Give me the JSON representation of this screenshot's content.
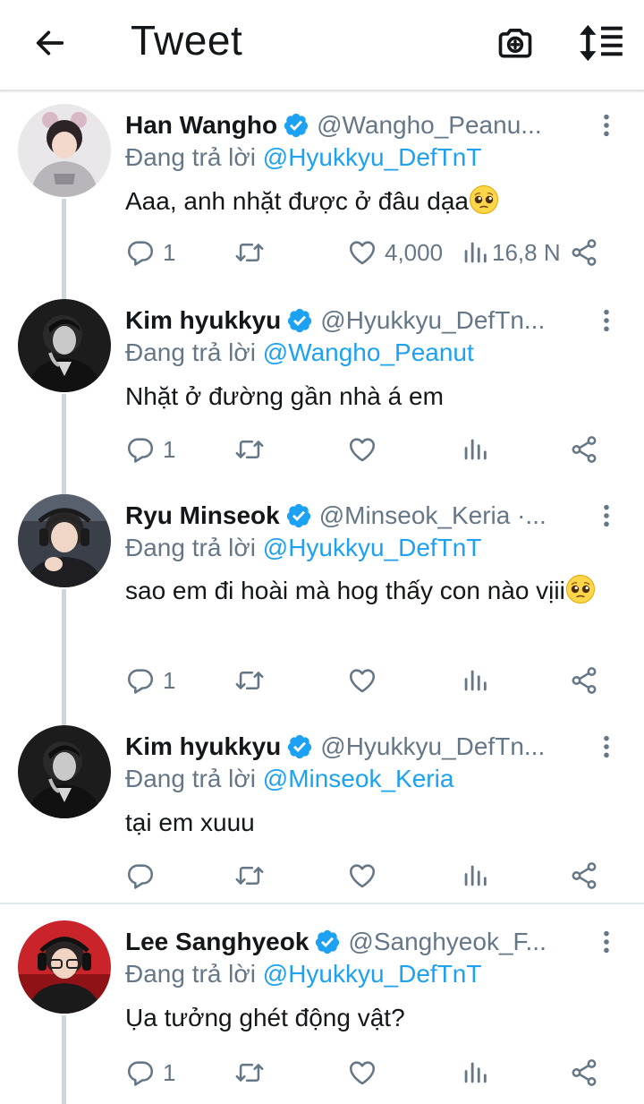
{
  "header": {
    "title": "Tweet",
    "back_icon": "arrow-left-icon",
    "camera_icon": "camera-plus-icon",
    "sort_icon": "sort-icon"
  },
  "colors": {
    "accent": "#1da1f2",
    "text_primary": "#14171a",
    "text_secondary": "#657786",
    "thread_line": "#ccd6dd",
    "divider": "#e1e8ed"
  },
  "tweets": [
    {
      "name": "Han Wangho",
      "handle": "@Wangho_Peanu...",
      "reply_prefix": "Đang trả lời",
      "reply_to": "@Hyukkyu_DefTnT",
      "text": "Aaa, anh nhặt được ở đâu dạa",
      "emoji": "pleading-face",
      "replies": "1",
      "retweets": "",
      "likes": "4,000",
      "views": "16,8 N"
    },
    {
      "name": "Kim hyukkyu",
      "handle": "@Hyukkyu_DefTn...",
      "reply_prefix": "Đang trả lời",
      "reply_to": "@Wangho_Peanut",
      "text": "Nhặt ở đường gần nhà á em",
      "emoji": "",
      "replies": "1",
      "retweets": "",
      "likes": "",
      "views": ""
    },
    {
      "name": "Ryu Minseok",
      "handle": "@Minseok_Keria ·...",
      "reply_prefix": "Đang trả lời",
      "reply_to": "@Hyukkyu_DefTnT",
      "text": "sao em đi hoài mà hog thấy con nào vịii",
      "emoji": "pleading-face",
      "replies": "1",
      "retweets": "",
      "likes": "",
      "views": ""
    },
    {
      "name": "Kim hyukkyu",
      "handle": "@Hyukkyu_DefTn...",
      "reply_prefix": "Đang trả lời",
      "reply_to": "@Minseok_Keria",
      "text": "tại em xuuu",
      "emoji": "",
      "replies": "",
      "retweets": "",
      "likes": "",
      "views": ""
    },
    {
      "name": "Lee Sanghyeok",
      "handle": "@Sanghyeok_F...",
      "reply_prefix": "Đang trả lời",
      "reply_to": "@Hyukkyu_DefTnT",
      "text": "Ụa tưởng ghét động vật?",
      "emoji": "",
      "replies": "1",
      "retweets": "",
      "likes": "",
      "views": ""
    }
  ]
}
